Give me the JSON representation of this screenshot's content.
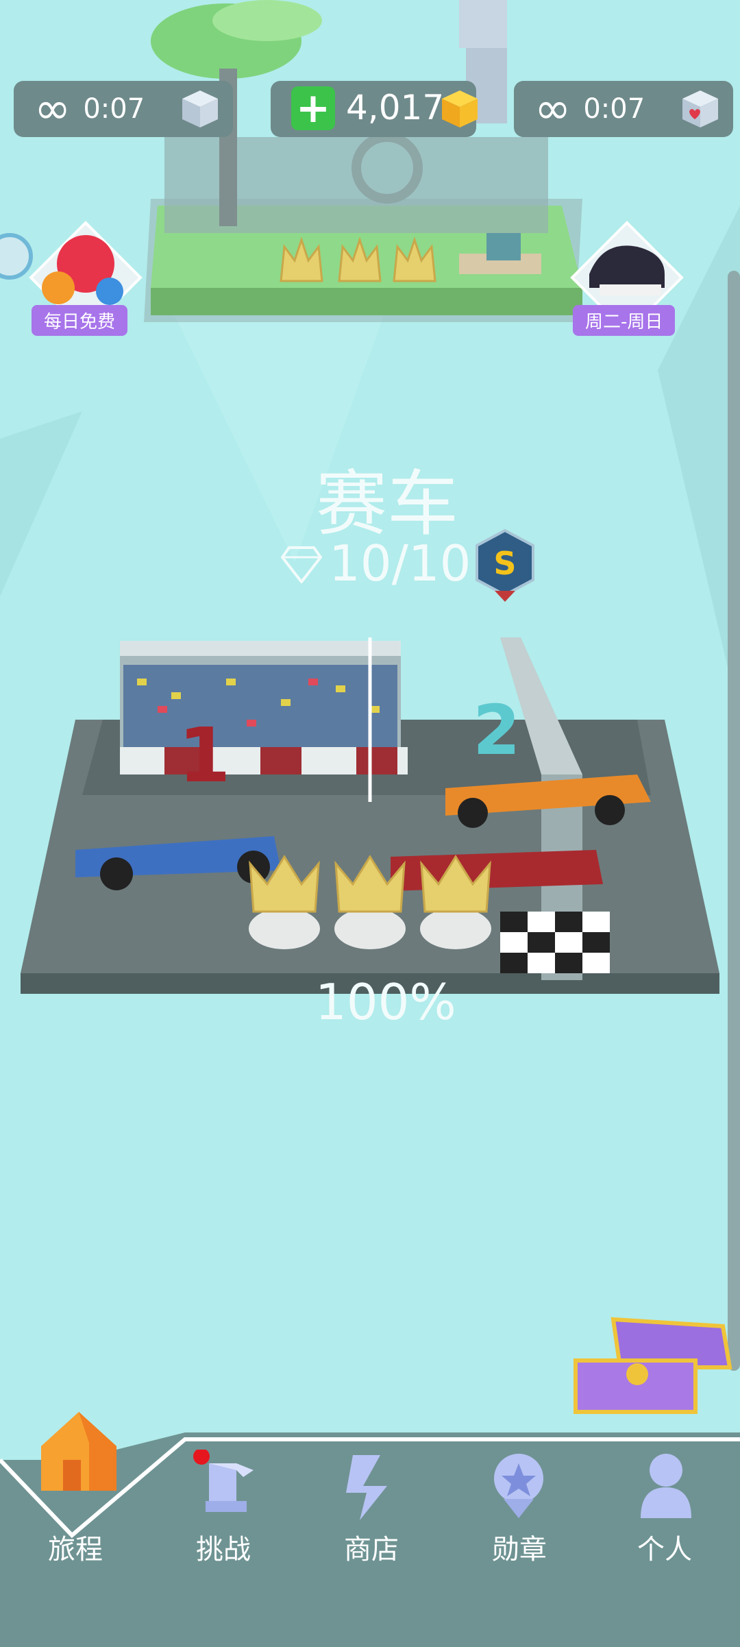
{
  "resources": {
    "left_timer": {
      "infinite": "∞",
      "time": "0:07",
      "icon": "cube-icon"
    },
    "coins": {
      "value": "4,017",
      "add_icon": "plus-icon",
      "icon": "gold-cube-icon"
    },
    "right_timer": {
      "infinite": "∞",
      "time": "0:07",
      "icon": "heart-cube-icon"
    }
  },
  "left_badge": {
    "label": "每日免费",
    "icon": "balloons-icon"
  },
  "right_badge": {
    "label": "周二-周日",
    "icon": "piano-icon"
  },
  "level": {
    "title": "赛车",
    "gems": "10/10",
    "rank": "S",
    "progress": "100%"
  },
  "nav": {
    "items": [
      {
        "label": "旅程",
        "icon": "home-icon"
      },
      {
        "label": "挑战",
        "icon": "challenge-icon"
      },
      {
        "label": "商店",
        "icon": "shop-icon"
      },
      {
        "label": "勋章",
        "icon": "medal-icon"
      },
      {
        "label": "个人",
        "icon": "profile-icon"
      }
    ]
  },
  "colors": {
    "background": "#b2ecec",
    "nav": "#6f9393",
    "coin_plus": "#3cc34a",
    "badge": "#a774ea"
  }
}
